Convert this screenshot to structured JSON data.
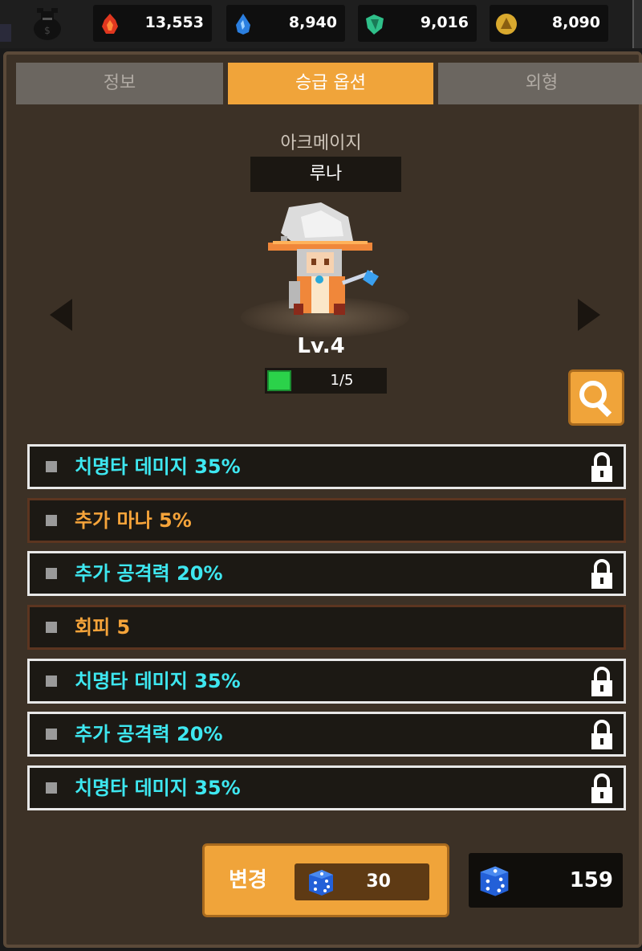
{
  "colors": {
    "accent": "#f0a43a",
    "panel": "#3c3126",
    "option_cyan": "#3ee7f0",
    "option_orange": "#f6a43a",
    "progress_green": "#2bd24a"
  },
  "currencies": [
    {
      "icon": "fire-gem-icon",
      "value": "13,553"
    },
    {
      "icon": "water-drop-icon",
      "value": "8,940"
    },
    {
      "icon": "green-crystal-icon",
      "value": "9,016"
    },
    {
      "icon": "gold-coin-icon",
      "value": "8,090"
    }
  ],
  "tabs": [
    "정보",
    "승급 옵션",
    "외형"
  ],
  "active_tab": 1,
  "character": {
    "class": "아크메이지",
    "name": "루나",
    "level": "Lv.4",
    "progress_text": "1/5",
    "progress": 0.2
  },
  "options": [
    {
      "label": "치명타 데미지 35%",
      "style": "cyan",
      "locked": true
    },
    {
      "label": "추가 마나 5%",
      "style": "orange",
      "locked": false
    },
    {
      "label": "추가 공격력 20%",
      "style": "cyan",
      "locked": true
    },
    {
      "label": "회피 5",
      "style": "orange",
      "locked": false
    },
    {
      "label": "치명타 데미지 35%",
      "style": "cyan",
      "locked": true
    },
    {
      "label": "추가 공격력 20%",
      "style": "cyan",
      "locked": true
    },
    {
      "label": "치명타 데미지 35%",
      "style": "cyan",
      "locked": true
    }
  ],
  "change_button": {
    "label": "변경",
    "cost": "30"
  },
  "dice_stock": "159"
}
